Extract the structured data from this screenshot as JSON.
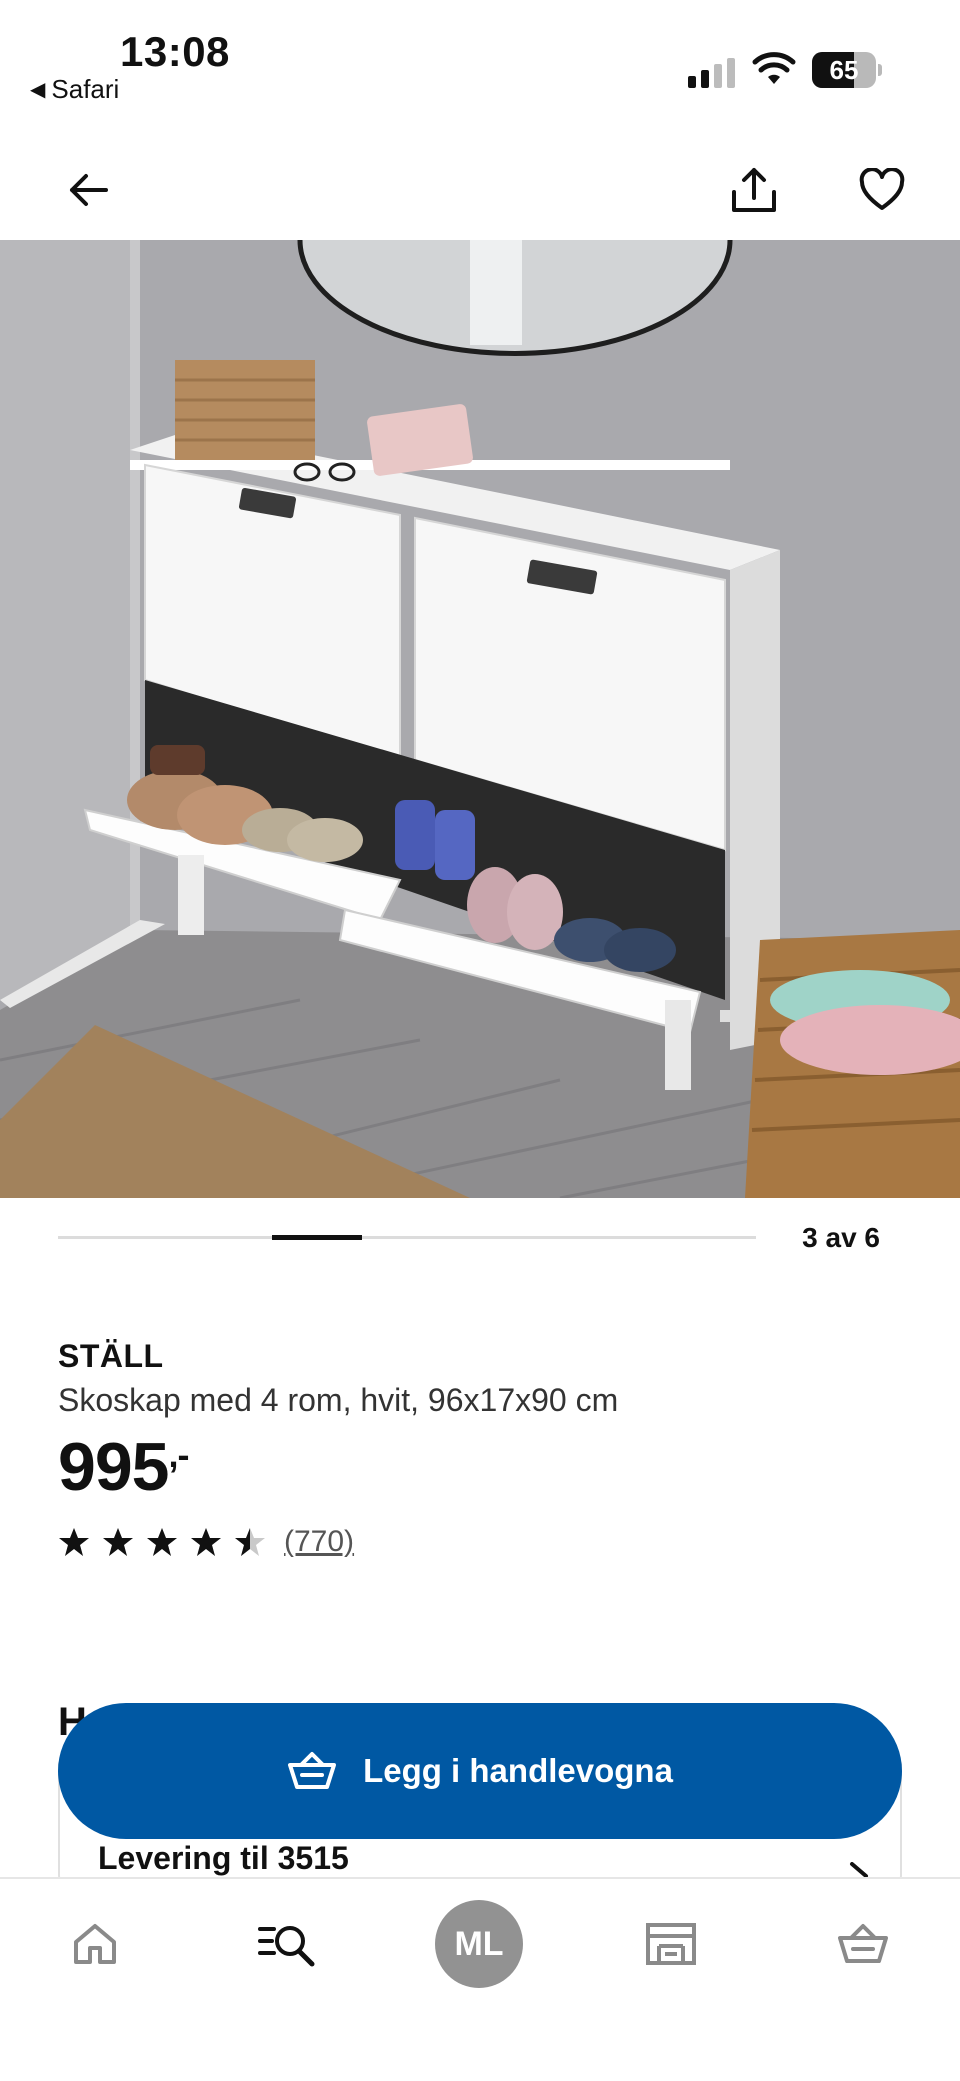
{
  "status_bar": {
    "time": "13:08",
    "back_app": "Safari",
    "back_glyph": "◀",
    "battery_percent": "65",
    "battery_level": 0.65,
    "icons": [
      "signal-icon",
      "wifi-icon",
      "battery-icon"
    ]
  },
  "top_nav": {
    "icons": [
      "arrow-left-icon",
      "share-icon",
      "heart-icon"
    ]
  },
  "hero": {
    "image": "product-photo"
  },
  "carousel": {
    "counter": "3 av 6",
    "current": 3,
    "total": 6
  },
  "product": {
    "name": "STÄLL",
    "description": "Skoskap med 4 rom, hvit, 96x17x90 cm",
    "price": "995",
    "price_suffix": ",-",
    "rating": 4.5,
    "review_count": "(770)"
  },
  "hidden_section": {
    "heading_partial": "H",
    "delivery_label": "Levering til 3515"
  },
  "cta": {
    "label": "Legg i handlevogna",
    "icon": "basket-icon",
    "color": "#0058a3"
  },
  "tab_bar": {
    "avatar_initials": "ML",
    "icons": [
      "home-icon",
      "search-list-icon",
      "avatar",
      "store-icon",
      "basket-icon"
    ]
  }
}
